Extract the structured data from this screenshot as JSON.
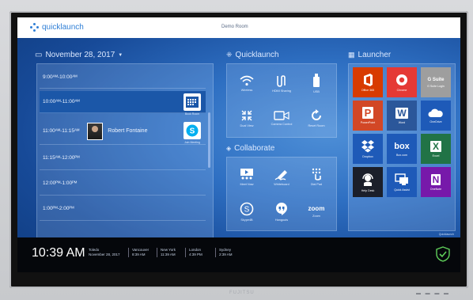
{
  "app": {
    "logo_text": "quicklaunch",
    "room": "Demo Room"
  },
  "calendar": {
    "date": "November 28, 2017",
    "slots": [
      {
        "time": "9:00ᴬᴹ-10:00ᴬᴹ",
        "person": "",
        "action": ""
      },
      {
        "time": "10:00ᴬᴹ-11:00ᴬᴹ",
        "person": "",
        "action": "Book Room"
      },
      {
        "time": "11:00ᴬᴹ-11:15ᴬᴹ",
        "person": "Robert Fontaine",
        "action": "Join Meeting"
      },
      {
        "time": "11:15ᴬᴹ-12:00ᴾᴹ",
        "person": "",
        "action": ""
      },
      {
        "time": "12:00ᴾᴹ-1:00ᴾᴹ",
        "person": "",
        "action": ""
      },
      {
        "time": "1:00ᴾᴹ-2:00ᴾᴹ",
        "person": "",
        "action": ""
      }
    ]
  },
  "quicklaunch": {
    "title": "Quicklaunch",
    "items": [
      {
        "label": "Wireless",
        "icon": "wifi-icon"
      },
      {
        "label": "HDMI Sharing",
        "icon": "hdmi-icon"
      },
      {
        "label": "USB",
        "icon": "usb-icon"
      },
      {
        "label": "Dual View",
        "icon": "dual-view-icon"
      },
      {
        "label": "Camera Control",
        "icon": "camera-icon"
      },
      {
        "label": "Reset Room",
        "icon": "reset-icon"
      }
    ]
  },
  "collaborate": {
    "title": "Collaborate",
    "items": [
      {
        "label": "Meet Now",
        "icon": "meet-now-icon"
      },
      {
        "label": "Whiteboard",
        "icon": "whiteboard-icon"
      },
      {
        "label": "Dial Pad",
        "icon": "dial-pad-icon"
      },
      {
        "label": "Skype4B",
        "icon": "skype-icon"
      },
      {
        "label": "Hangouts",
        "icon": "hangouts-icon"
      },
      {
        "label": "Zoom",
        "icon": "zoom-icon",
        "glyph": "zoom"
      }
    ]
  },
  "launcher": {
    "title": "Launcher",
    "apps": [
      {
        "label": "Office 365",
        "glyph": "",
        "color": "#d83b01"
      },
      {
        "label": "Chrome",
        "glyph": "",
        "color": "#e53935"
      },
      {
        "label": "G Suite Login",
        "glyph": "G Suite",
        "color": "#9e9e9e"
      },
      {
        "label": "PowerPoint",
        "glyph": "P",
        "color": "#d24726"
      },
      {
        "label": "Word",
        "glyph": "W",
        "color": "#2b579a"
      },
      {
        "label": "OneDrive",
        "glyph": "",
        "color": "#1e5ab8"
      },
      {
        "label": "Dropbox",
        "glyph": "",
        "color": "#1e5ab8"
      },
      {
        "label": "Box.com",
        "glyph": "box",
        "color": "#1e5ab8"
      },
      {
        "label": "Excel",
        "glyph": "X",
        "color": "#217346"
      },
      {
        "label": "Help Desk",
        "glyph": "",
        "color": "#1b1f2a"
      },
      {
        "label": "Quick Assist",
        "glyph": "",
        "color": "#1e5ab8"
      },
      {
        "label": "OneNote",
        "glyph": "N",
        "color": "#7719aa"
      }
    ]
  },
  "footer": {
    "time": "10:39 AM",
    "zones": [
      {
        "city": "Toledo",
        "time": "November 28, 2017"
      },
      {
        "city": "Vancouver",
        "time": "8:39 AM"
      },
      {
        "city": "New York",
        "time": "11:39 AM"
      },
      {
        "city": "London",
        "time": "4:39 PM"
      },
      {
        "city": "Sydney",
        "time": "2:39 AM"
      }
    ],
    "tagline": "Quicklaunch"
  },
  "hardware": {
    "brand": "FUJITSU",
    "indicators": "▬ ▬ ▬ ▬"
  },
  "colors": {
    "accent": "#2f7fd6",
    "active_slot": "#1b57a8"
  }
}
